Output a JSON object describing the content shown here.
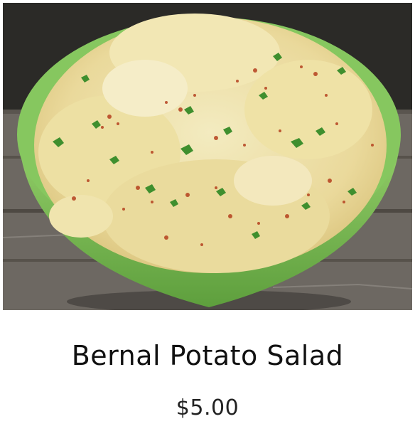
{
  "product": {
    "image_alt": "Bernal Potato Salad in a green bowl",
    "title": "Bernal Potato Salad",
    "price": "$5.00"
  },
  "colors": {
    "bowl": "#7fc25a",
    "salad": "#efe3a4",
    "paprika": "#b5401e",
    "parsley": "#3f8f2e",
    "wood": "#6f6a62"
  }
}
